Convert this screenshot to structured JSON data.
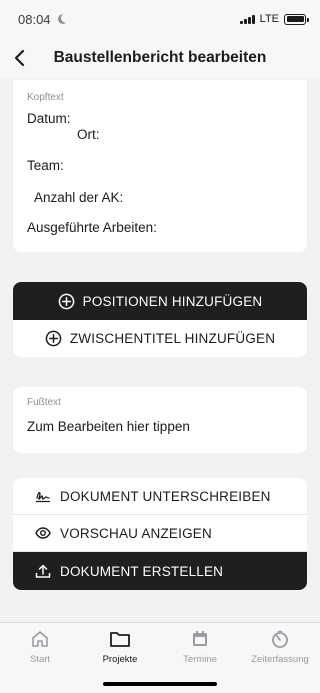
{
  "status_bar": {
    "time": "08:04",
    "network": "LTE",
    "battery_icon": "battery-icon",
    "signal_icon": "signal-icon",
    "moon_icon": "moon-icon"
  },
  "nav": {
    "title": "Baustellenbericht bearbeiten",
    "back_icon": "chevron-left-icon"
  },
  "header_section": {
    "label": "Kopftext",
    "fields": {
      "datum": "Datum:",
      "ort": "Ort:",
      "team": "Team:",
      "anzahl_ak": "Anzahl der AK:",
      "arbeiten": "Ausgeführte Arbeiten:"
    }
  },
  "add_buttons": {
    "positions": "POSITIONEN HINZUFÜGEN",
    "subtitle": "ZWISCHENTITEL HINZUFÜGEN"
  },
  "footer_section": {
    "label": "Fußtext",
    "text": "Zum Bearbeiten hier tippen"
  },
  "actions": {
    "sign": "DOKUMENT UNTERSCHREIBEN",
    "preview": "VORSCHAU ANZEIGEN",
    "create": "DOKUMENT ERSTELLEN"
  },
  "tabs": [
    {
      "label": "Start",
      "icon": "home-icon",
      "active": false
    },
    {
      "label": "Projekte",
      "icon": "folder-icon",
      "active": true
    },
    {
      "label": "Termine",
      "icon": "calendar-icon",
      "active": false
    },
    {
      "label": "Zeiterfassung",
      "icon": "timer-icon",
      "active": false
    }
  ],
  "colors": {
    "accent_dark": "#1f1f21",
    "background": "#f2f2f4",
    "muted": "#8e8e93"
  }
}
